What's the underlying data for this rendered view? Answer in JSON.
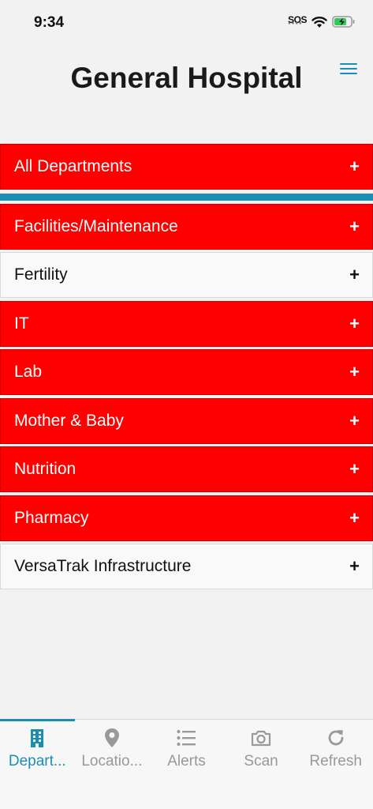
{
  "status": {
    "time": "9:34",
    "sos": "SOS",
    "battery_color": "#34c759"
  },
  "header": {
    "title": "General Hospital",
    "menu_icon": "hamburger-menu-icon",
    "accent": "#1b8fb3"
  },
  "departments": {
    "all": {
      "label": "All Departments",
      "plus": "+"
    },
    "items": [
      {
        "label": "Facilities/Maintenance",
        "plus": "+",
        "status": "alert"
      },
      {
        "label": "Fertility",
        "plus": "+",
        "status": "normal"
      },
      {
        "label": "IT",
        "plus": "+",
        "status": "alert"
      },
      {
        "label": "Lab",
        "plus": "+",
        "status": "alert"
      },
      {
        "label": "Mother & Baby",
        "plus": "+",
        "status": "alert"
      },
      {
        "label": "Nutrition",
        "plus": "+",
        "status": "alert"
      },
      {
        "label": "Pharmacy",
        "plus": "+",
        "status": "alert"
      },
      {
        "label": "VersaTrak Infrastructure",
        "plus": "+",
        "status": "normal"
      }
    ],
    "alert_color": "#ff0000"
  },
  "tabs": [
    {
      "label": "Depart...",
      "icon": "building-icon",
      "active": true
    },
    {
      "label": "Locatio...",
      "icon": "location-pin-icon",
      "active": false
    },
    {
      "label": "Alerts",
      "icon": "list-icon",
      "active": false
    },
    {
      "label": "Scan",
      "icon": "camera-icon",
      "active": false
    },
    {
      "label": "Refresh",
      "icon": "refresh-icon",
      "active": false
    }
  ]
}
